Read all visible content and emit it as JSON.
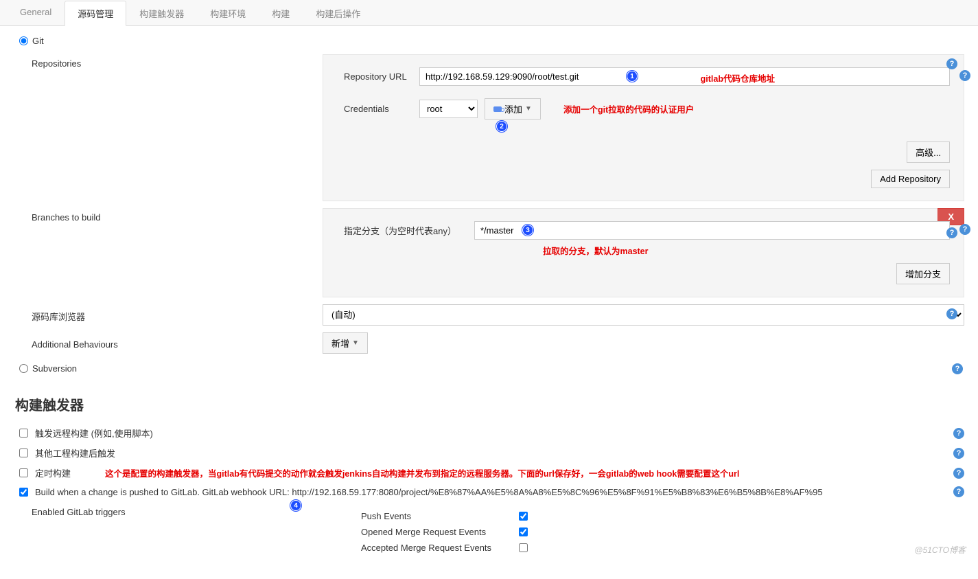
{
  "tabs": {
    "general": "General",
    "scm": "源码管理",
    "triggers": "构建触发器",
    "env": "构建环境",
    "build": "构建",
    "post": "构建后操作"
  },
  "scm": {
    "git_radio": "Git",
    "repositories_label": "Repositories",
    "repo_url_label": "Repository URL",
    "repo_url_value": "http://192.168.59.129:9090/root/test.git",
    "note_repo": "gitlab代码仓库地址",
    "credentials_label": "Credentials",
    "credentials_value": "root",
    "add_btn": "添加",
    "note_cred": "添加一个git拉取的代码的认证用户",
    "advanced_btn": "高级...",
    "add_repo_btn": "Add Repository",
    "branches_label": "Branches to build",
    "branch_spec_label": "指定分支（为空时代表any）",
    "branch_value": "*/master",
    "note_branch": "拉取的分支，默认为master",
    "delete_x": "X",
    "add_branch_btn": "增加分支",
    "browser_label": "源码库浏览器",
    "browser_value": "(自动)",
    "behaviours_label": "Additional Behaviours",
    "behaviours_btn": "新增",
    "svn_radio": "Subversion"
  },
  "triggers": {
    "heading": "构建触发器",
    "remote": "触发远程构建 (例如,使用脚本)",
    "after_other": "其他工程构建后触发",
    "timed": "定时构建",
    "note_main": "这个是配置的构建触发器，当gitlab有代码提交的动作就会触发jenkins自动构建并发布到指定的远程服务器。下面的url保存好，一会gitlab的web hook需要配置这个url",
    "gitlab_push": "Build when a change is pushed to GitLab. GitLab webhook URL: http://192.168.59.177:8080/project/%E8%87%AA%E5%8A%A8%E5%8C%96%E5%8F%91%E5%B8%83%E6%B5%8B%E8%AF%95",
    "enabled_label": "Enabled GitLab triggers",
    "push_events": "Push Events",
    "opened_mr": "Opened Merge Request Events",
    "accepted_mr": "Accepted Merge Request Events"
  },
  "watermark": "@51CTO博客"
}
